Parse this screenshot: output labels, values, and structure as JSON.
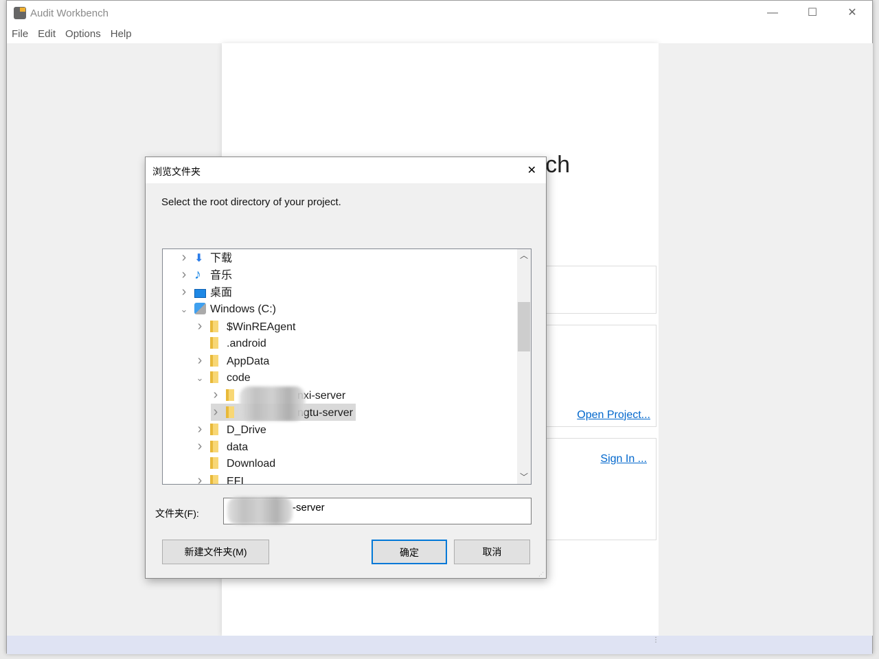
{
  "window": {
    "title": "Audit Workbench",
    "minimize": "—",
    "maximize": "☐",
    "close": "✕"
  },
  "menu": [
    "File",
    "Edit",
    "Options",
    "Help"
  ],
  "center": {
    "heading_visible": "ch",
    "open_project": "Open Project...",
    "sign_in": "Sign In ..."
  },
  "dialog": {
    "title": "浏览文件夹",
    "close": "✕",
    "prompt": "Select the root directory of your project.",
    "tree": [
      {
        "label": "下载",
        "icon": "download-arrow-icon",
        "expander": "collapsed"
      },
      {
        "label": "音乐",
        "icon": "music-note-icon",
        "expander": "collapsed"
      },
      {
        "label": "桌面",
        "icon": "desktop-icon",
        "expander": "collapsed"
      },
      {
        "label": "Windows (C:)",
        "icon": "drive-icon",
        "expander": "expanded"
      },
      {
        "label": "$WinREAgent",
        "icon": "folder-icon",
        "expander": "collapsed"
      },
      {
        "label": ".android",
        "icon": "folder-icon",
        "expander": "none"
      },
      {
        "label": "AppData",
        "icon": "folder-icon",
        "expander": "collapsed"
      },
      {
        "label": "code",
        "icon": "folder-icon",
        "expander": "expanded"
      },
      {
        "label": "nxi-server",
        "icon": "folder-icon",
        "expander": "collapsed"
      },
      {
        "label": "ngtu-server",
        "icon": "folder-icon",
        "expander": "collapsed",
        "selected": true
      },
      {
        "label": "D_Drive",
        "icon": "folder-icon",
        "expander": "collapsed"
      },
      {
        "label": "data",
        "icon": "folder-icon",
        "expander": "collapsed"
      },
      {
        "label": "Download",
        "icon": "folder-icon",
        "expander": "none"
      },
      {
        "label": "EFI",
        "icon": "folder-icon",
        "expander": "collapsed"
      }
    ],
    "folder_label": "文件夹(F):",
    "folder_value": "-server",
    "new_folder": "新建文件夹(M)",
    "ok": "确定",
    "cancel": "取消"
  },
  "colors": {
    "link": "#0066cc",
    "status_bar": "#dfe3f3",
    "selection": "#d9d9d9"
  }
}
